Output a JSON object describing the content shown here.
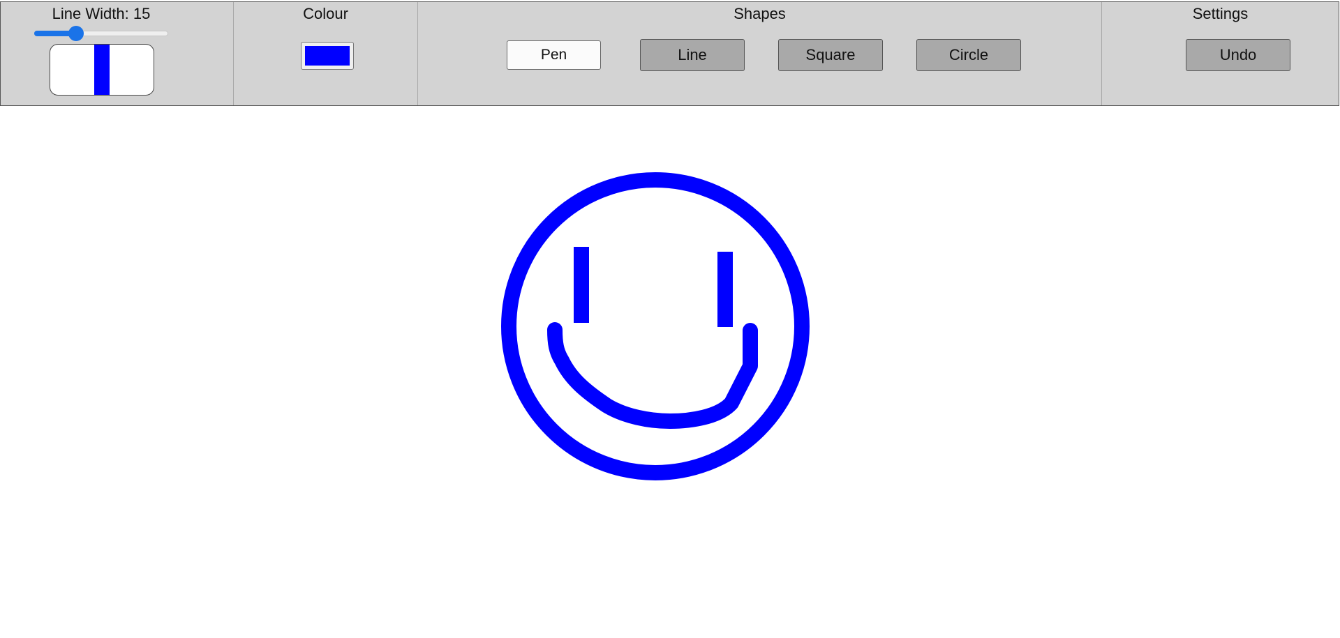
{
  "toolbar": {
    "line_width": {
      "title": "Line Width: 15",
      "value": 15,
      "min": 1,
      "max": 50
    },
    "colour": {
      "title": "Colour",
      "selected": "#0000ff"
    },
    "shapes": {
      "title": "Shapes",
      "pen_label": "Pen",
      "line_label": "Line",
      "square_label": "Square",
      "circle_label": "Circle",
      "active_tool": "Pen"
    },
    "settings": {
      "title": "Settings",
      "undo_label": "Undo"
    }
  },
  "theme": {
    "toolbar_bg": "#d3d3d3",
    "button_bg": "#a9a9a9",
    "active_button_bg": "#fbfbfb",
    "accent": "#1a73e8",
    "stroke_colour": "#0000ff"
  }
}
